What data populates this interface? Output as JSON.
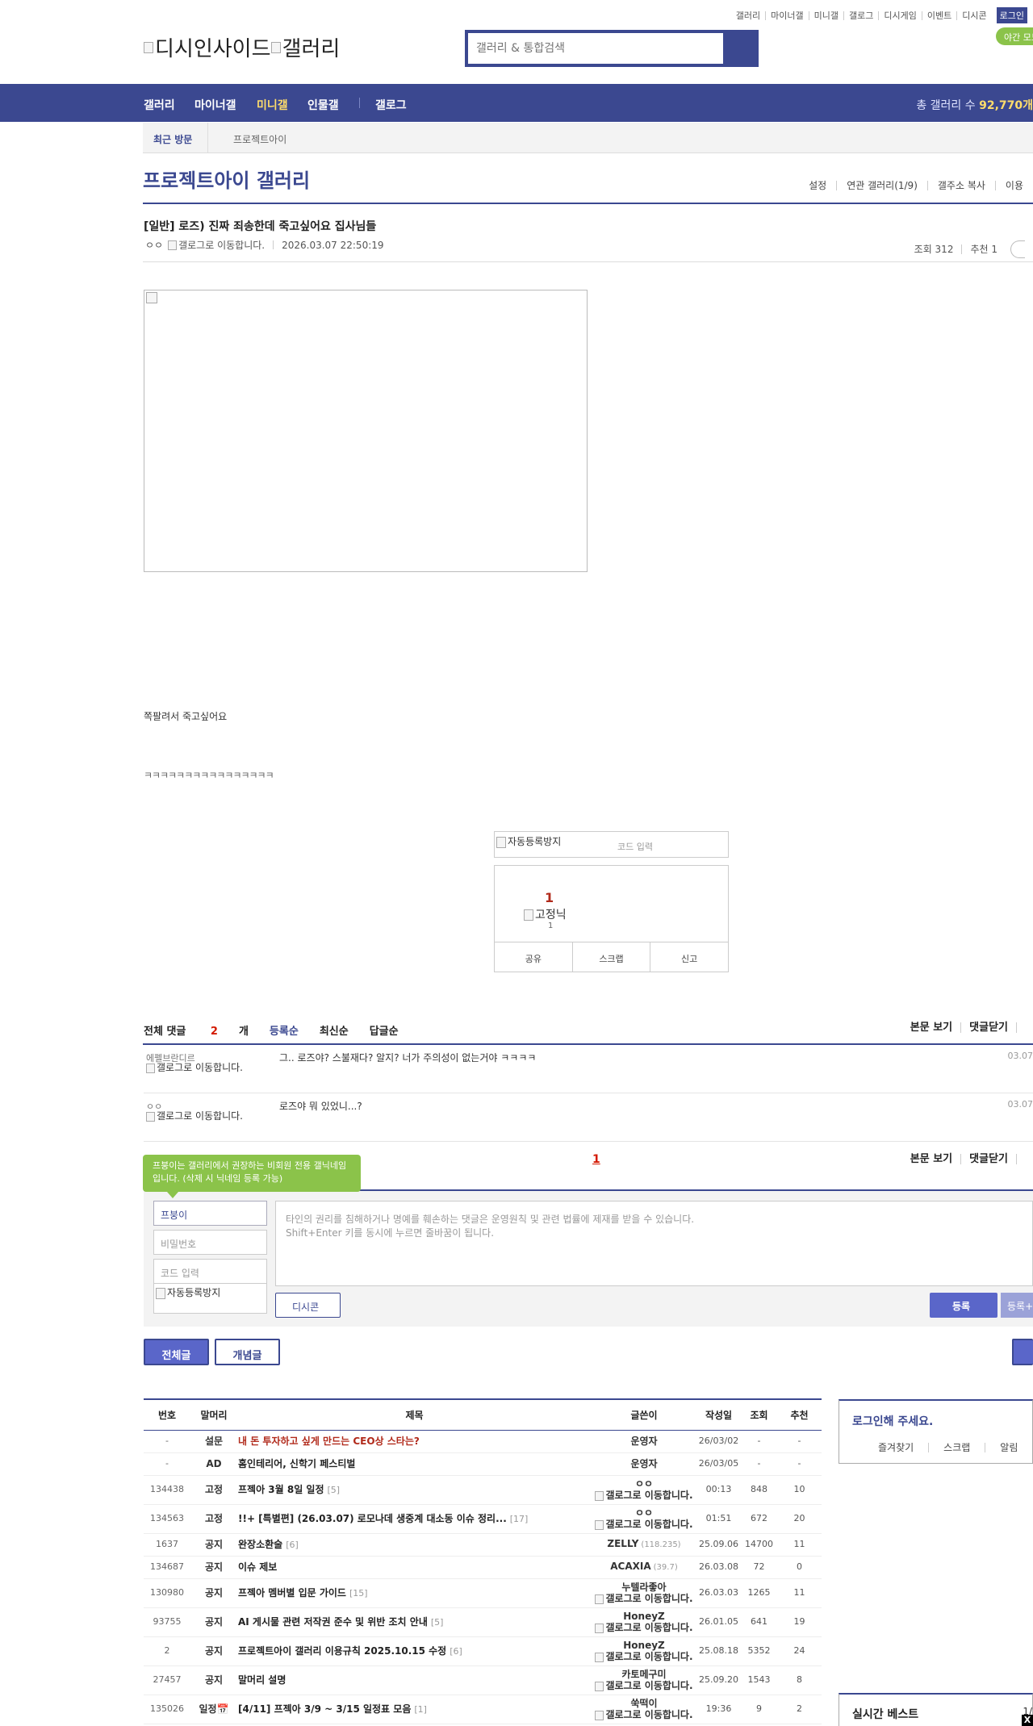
{
  "util_menu": {
    "items": [
      "갤러리",
      "마이너갤",
      "미니갤",
      "갤로그",
      "디시게임",
      "이벤트",
      "디시콘"
    ],
    "login": "로그인",
    "night_mode": "야간 모드"
  },
  "header": {
    "logo1_alt": "디시인사이드",
    "logo2_alt": "갤러리",
    "search_placeholder": "갤러리 & 통합검색"
  },
  "nav": {
    "items": [
      "갤러리",
      "마이너갤",
      "미니갤",
      "인물갤",
      "갤로그"
    ],
    "active_index": 2,
    "total_label": "총 갤러리 수 ",
    "total_value": "92,770개"
  },
  "recent": {
    "label": "최근 방문",
    "gallery": "프로젝트아이"
  },
  "gallery": {
    "title": "프로젝트아이 갤러리",
    "menu": [
      "설정",
      "연관 갤러리(1/9)",
      "갤주소 복사",
      "이용"
    ]
  },
  "post": {
    "title": "[일반] 로즈) 진짜 죄송한데 죽고싶어요 집사님들",
    "author": "ㅇㅇ",
    "author_img_alt": "갤로그로 이동합니다.",
    "date": "2026.03.07 22:50:19",
    "views": "조회 312",
    "recommend": "추천 1",
    "line1": "쪽팔려서 죽고싶어요",
    "line2": "ㅋㅋㅋㅋㅋㅋㅋㅋㅋㅋㅋㅋㅋㅋㅋㅋ"
  },
  "recommend_box": {
    "captcha_alt": "자동등록방지",
    "captcha_placeholder": "코드 입력",
    "count": "1",
    "fixed_img_alt": "고정닉",
    "fixed_count": "1",
    "buttons": [
      "공유",
      "스크랩",
      "신고"
    ]
  },
  "comments": {
    "total_label": "전체 댓글 ",
    "total_num": "2",
    "total_unit": "개",
    "sorts": [
      "등록순",
      "최신순",
      "답글순"
    ],
    "right_links": [
      "본문 보기",
      "댓글닫기"
    ],
    "items": [
      {
        "nick": "에펠브란디르",
        "img_alt": "갤로그로 이동합니다.",
        "text": "그.. 로즈야? 스불재다? 알지? 너가 주의성이 없는거야 ㅋㅋㅋㅋ",
        "date": "03.07"
      },
      {
        "nick": "ㅇㅇ",
        "img_alt": "갤로그로 이동합니다.",
        "text": "로즈야 뭐 있었니...?",
        "date": "03.07"
      }
    ],
    "page": "1"
  },
  "write_form": {
    "tooltip": "프붕이는 갤러리에서 권장하는 비회원 전용 갤닉네임입니다. (삭제 시 닉네임 등록 가능)",
    "nick_value": "프붕이",
    "password_placeholder": "비밀번호",
    "code_placeholder": "코드 입력",
    "captcha_alt": "자동등록방지",
    "textarea_line1": "타인의 권리를 침해하거나 명예를 훼손하는 댓글은 운영원칙 및 관련 법률에 제재를 받을 수 있습니다.",
    "textarea_line2": "Shift+Enter 키를 동시에 누르면 줄바꿈이 됩니다.",
    "dccon": "디시콘",
    "submit": "등록",
    "submit2": "등록+추천"
  },
  "list_tabs": {
    "all": "전체글",
    "concept": "개념글"
  },
  "list": {
    "headers": [
      "번호",
      "말머리",
      "제목",
      "글쓴이",
      "작성일",
      "조회",
      "추천"
    ],
    "rows": [
      {
        "num": "-",
        "head": "설문",
        "title": "내 돈 투자하고 싶게 만드는 CEO상 스타는?",
        "reply": "",
        "red": true,
        "writer": "운영자",
        "ip": "",
        "wimg": "",
        "date": "26/03/02",
        "views": "-",
        "rec": "-"
      },
      {
        "num": "-",
        "head": "AD",
        "title": "홈인테리어, 신학기 페스티벌",
        "reply": "",
        "red": false,
        "writer": "운영자",
        "ip": "",
        "wimg": "",
        "date": "26/03/05",
        "views": "-",
        "rec": "-"
      },
      {
        "num": "134438",
        "head": "고정",
        "title": "프젝아 3월 8일 일정",
        "reply": "[5]",
        "red": false,
        "writer": "ㅇㅇ",
        "ip": "",
        "wimg": "갤로그로 이동합니다.",
        "date": "00:13",
        "views": "848",
        "rec": "10"
      },
      {
        "num": "134563",
        "head": "고정",
        "title": "!!+ [특별편] (26.03.07) 로모나데 생중계 대소동 이슈 정리...",
        "reply": "[17]",
        "red": false,
        "writer": "ㅇㅇ",
        "ip": "",
        "wimg": "갤로그로 이동합니다.",
        "date": "01:51",
        "views": "672",
        "rec": "20"
      },
      {
        "num": "1637",
        "head": "공지",
        "title": "완장소환술",
        "reply": "[6]",
        "red": false,
        "writer": "ZELLY",
        "ip": "(118.235)",
        "wimg": "",
        "date": "25.09.06",
        "views": "14700",
        "rec": "11"
      },
      {
        "num": "134687",
        "head": "공지",
        "title": "이슈 제보",
        "reply": "",
        "red": false,
        "writer": "ACAXIA",
        "ip": "(39.7)",
        "wimg": "",
        "date": "26.03.08",
        "views": "72",
        "rec": "0"
      },
      {
        "num": "130980",
        "head": "공지",
        "title": "프젝아 멤버별 입문 가이드",
        "reply": "[15]",
        "red": false,
        "writer": "누텔라좋아",
        "ip": "",
        "wimg": "갤로그로 이동합니다.",
        "date": "26.03.03",
        "views": "1265",
        "rec": "11"
      },
      {
        "num": "93755",
        "head": "공지",
        "title": "AI 게시물 관련 저작권 준수 및 위반 조치 안내",
        "reply": "[5]",
        "red": false,
        "writer": "HoneyZ",
        "ip": "",
        "wimg": "갤로그로 이동합니다.",
        "date": "26.01.05",
        "views": "641",
        "rec": "19"
      },
      {
        "num": "2",
        "head": "공지",
        "title": "프로젝트아이 갤러리 이용규칙 2025.10.15 수정",
        "reply": "[6]",
        "red": false,
        "writer": "HoneyZ",
        "ip": "",
        "wimg": "갤로그로 이동합니다.",
        "date": "25.08.18",
        "views": "5352",
        "rec": "24"
      },
      {
        "num": "27457",
        "head": "공지",
        "title": "말머리 설명",
        "reply": "",
        "red": false,
        "writer": "카토메구미",
        "ip": "",
        "wimg": "갤로그로 이동합니다.",
        "date": "25.09.20",
        "views": "1543",
        "rec": "8"
      },
      {
        "num": "135026",
        "head": "일정📅",
        "title": "[4/11] 프젝아 3/9 ~ 3/15 일정표 모음",
        "reply": "[1]",
        "red": false,
        "writer": "쑥떡이",
        "ip": "",
        "wimg": "갤로그로 이동합니다.",
        "date": "19:36",
        "views": "9",
        "rec": "2"
      }
    ]
  },
  "sidebar": {
    "login_prompt": "로그인해 주세요.",
    "login_menu": [
      "즐겨찾기",
      "스크랩",
      "알림"
    ],
    "best_title": "실시간 베스트",
    "best_page": "1/"
  },
  "close_x": "X"
}
